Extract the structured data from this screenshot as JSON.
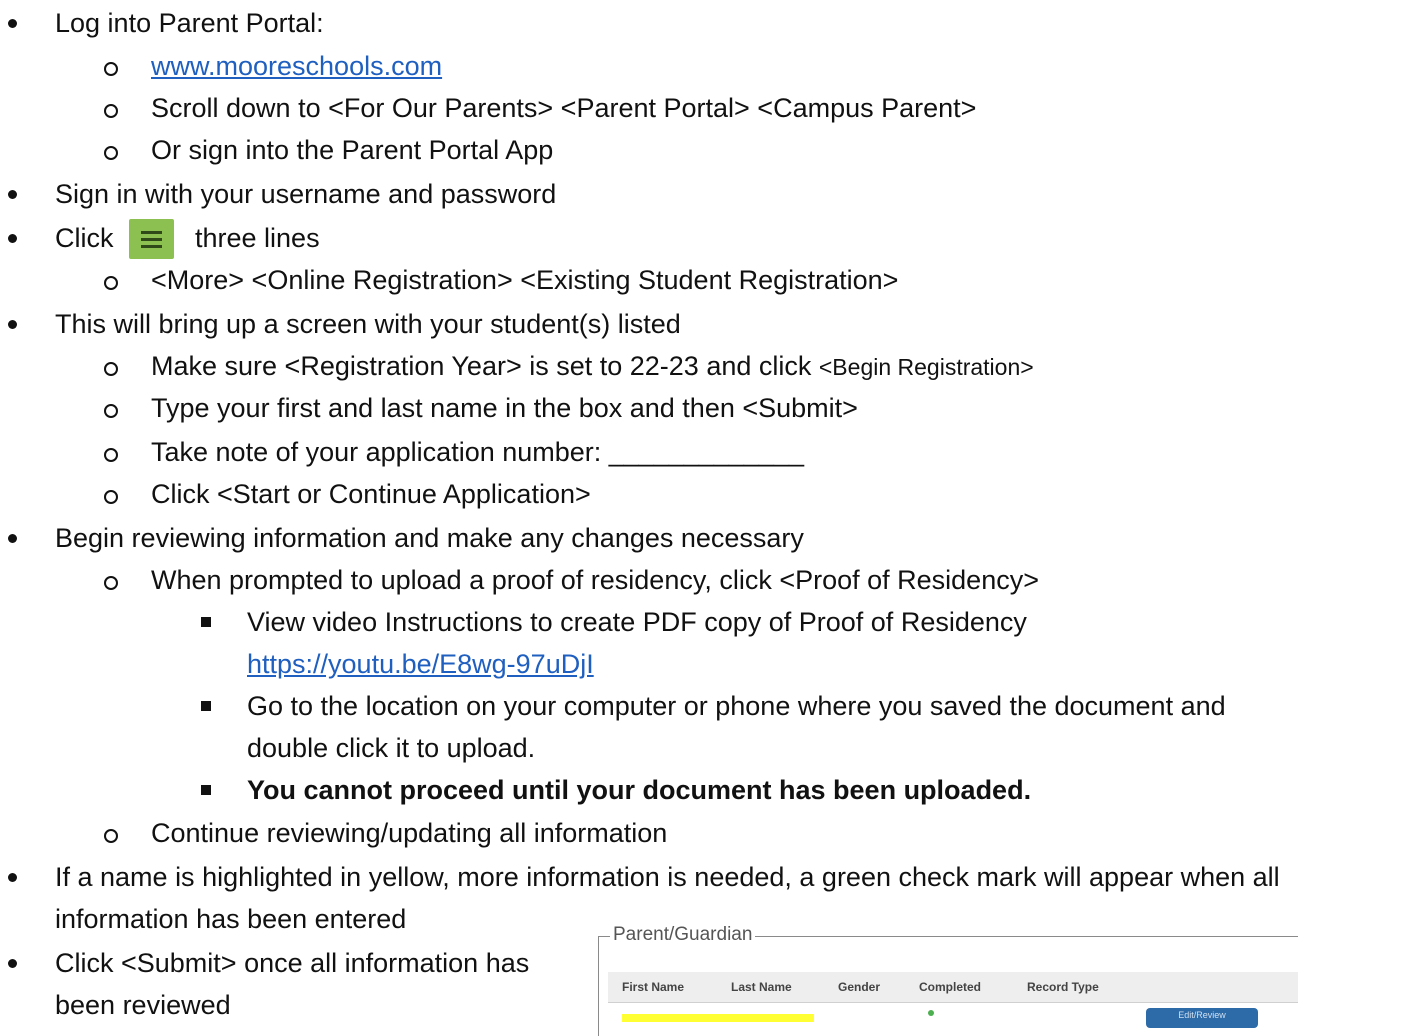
{
  "steps": {
    "s1": "Log into Parent Portal:",
    "s1a_link": "www.mooreschools.com",
    "s1b": "Scroll down to <For Our Parents> <Parent Portal> <Campus Parent>",
    "s1c": "Or sign into the Parent Portal App",
    "s2": "Sign in with your username and password",
    "s3_click": "Click",
    "s3_lines": "three lines",
    "s3a": "<More> <Online Registration> <Existing Student  Registration>",
    "s4": "This will bring up a screen with your student(s)  listed",
    "s4a_main": "Make sure <Registration Year> is set to 22-23 and click ",
    "s4a_small": "<Begin Registration>",
    "s4b": "Type your first and last name in the box and then <Submit>",
    "s4c": "Take note of your application number: _____________",
    "s4d": "Click <Start or Continue  Application>",
    "s5": "Begin reviewing information and make any changes necessary",
    "s5a": "When prompted to upload a proof of residency, click <Proof of Residency>",
    "s5a1": "View video Instructions  to create PDF copy of Proof of Residency",
    "s5a1_link": "https://youtu.be/E8wg-97uDjI",
    "s5a2": "Go to the location on your  computer or phone  where you saved the document  and",
    "s5a2_cont": "double  click it to upload.",
    "s5a3": "You cannot proceed until your document has been uploaded.",
    "s5b": "Continue  reviewing/updating all information",
    "s6": "If a name is highlighted in yellow, more information is needed, a green check mark will appear when all",
    "s6_cont": "information has been entered",
    "s7": "Click <Submit> once all information has",
    "s7_cont": "been reviewed"
  },
  "icons": {
    "menu": "hamburger-menu-icon",
    "menu_color": "#8cc152"
  },
  "parent_guardian_panel": {
    "legend": "Parent/Guardian",
    "columns": [
      "First Name",
      "Last Name",
      "Gender",
      "Completed",
      "Record Type"
    ],
    "button": "Edit/Review"
  },
  "colors": {
    "link": "#1f5fbf",
    "highlight": "#ffff33",
    "check": "#4caf50",
    "button": "#2c6aa8"
  }
}
